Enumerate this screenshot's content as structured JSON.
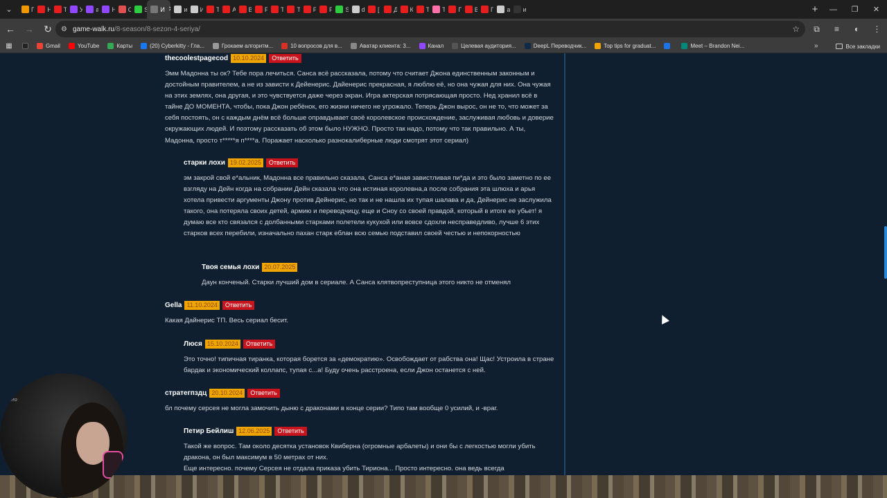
{
  "browser": {
    "tabs": [
      {
        "text": "П",
        "color": "#f29900",
        "icon": "page-icon"
      },
      {
        "text": "Н",
        "color": "#e81e1e",
        "icon": "youtube-icon"
      },
      {
        "text": "Т",
        "color": "#e81e1e",
        "icon": "youtube-icon"
      },
      {
        "text": "У",
        "color": "#9146ff",
        "icon": "twitch-icon"
      },
      {
        "text": "а",
        "color": "#9146ff",
        "icon": "twitch-icon"
      },
      {
        "text": "Н",
        "color": "#9146ff",
        "icon": "twitch-icon"
      },
      {
        "text": "С",
        "color": "#e05050",
        "icon": "page-icon"
      },
      {
        "text": "S",
        "color": "#2ecc40",
        "icon": "page-icon"
      },
      {
        "text": "И",
        "color": "#777777",
        "icon": "page-icon",
        "active": true
      },
      {
        "text": "и",
        "color": "#cccccc",
        "icon": "google-icon"
      },
      {
        "text": "И",
        "color": "#cccccc",
        "icon": "page-icon"
      },
      {
        "text": "Т",
        "color": "#e81e1e",
        "icon": "youtube-icon"
      },
      {
        "text": "А",
        "color": "#e81e1e",
        "icon": "youtube-icon"
      },
      {
        "text": "В",
        "color": "#e81e1e",
        "icon": "youtube-icon"
      },
      {
        "text": "F",
        "color": "#e81e1e",
        "icon": "youtube-icon"
      },
      {
        "text": "Т",
        "color": "#e81e1e",
        "icon": "youtube-icon"
      },
      {
        "text": "Т",
        "color": "#e81e1e",
        "icon": "youtube-icon"
      },
      {
        "text": "Р",
        "color": "#e81e1e",
        "icon": "youtube-icon"
      },
      {
        "text": "F",
        "color": "#e81e1e",
        "icon": "youtube-icon"
      },
      {
        "text": "S",
        "color": "#2ecc40",
        "icon": "page-icon"
      },
      {
        "text": "d",
        "color": "#cccccc",
        "icon": "google-icon"
      },
      {
        "text": "[",
        "color": "#e81e1e",
        "icon": "youtube-icon"
      },
      {
        "text": "Д",
        "color": "#e81e1e",
        "icon": "youtube-icon"
      },
      {
        "text": "К",
        "color": "#e81e1e",
        "icon": "youtube-icon"
      },
      {
        "text": "Т",
        "color": "#e81e1e",
        "icon": "youtube-icon"
      },
      {
        "text": "Т",
        "color": "#ff6fa8",
        "icon": "page-icon"
      },
      {
        "text": "Г",
        "color": "#e81e1e",
        "icon": "youtube-icon"
      },
      {
        "text": "В",
        "color": "#e81e1e",
        "icon": "youtube-icon"
      },
      {
        "text": "Г",
        "color": "#e81e1e",
        "icon": "youtube-icon"
      },
      {
        "text": "а",
        "color": "#cccccc",
        "icon": "google-icon"
      },
      {
        "text": "и",
        "color": "#333333",
        "icon": "page-icon"
      }
    ],
    "url_host": "game-walk.ru",
    "url_path": "/8-season/8-sezon-4-seriya/",
    "bookmarks": [
      {
        "label": "Gmail",
        "color": "#ea4335"
      },
      {
        "label": "YouTube",
        "color": "#ff0000"
      },
      {
        "label": "Карты",
        "color": "#34a853"
      },
      {
        "label": "(20) Cyberkitty - Гла...",
        "color": "#1877f2"
      },
      {
        "label": "Грокаем алгоритм...",
        "color": "#999999"
      },
      {
        "label": "10 вопросов для в...",
        "color": "#d93025"
      },
      {
        "label": "Аватар клиента: 3...",
        "color": "#888888"
      },
      {
        "label": "Канал",
        "color": "#9146ff"
      },
      {
        "label": "Целевая аудитория...",
        "color": "#555555"
      },
      {
        "label": "DeepL Переводчик...",
        "color": "#0f2b46"
      },
      {
        "label": "Top tips for graduat...",
        "color": "#f0a500"
      },
      {
        "label": "",
        "color": "#1a73e8"
      },
      {
        "label": "Meet – Brandon Nei...",
        "color": "#00897b"
      }
    ],
    "bookmarks_all": "Все закладки"
  },
  "comments": [
    {
      "author": "thecoolestpagecod",
      "date": "10.10.2024",
      "reply": "Ответить",
      "text": "Эмм Мадонна ты ок? Тебе пора лечиться. Санса всё рассказала, потому что считает Джона единственным законным и достойным правителем, а не из зависти к Дейенерис. Дайенерис прекрасная, я люблю её, но она чужая для них. Она чужая на этих землях, она другая, и это чувствуется даже через экран. Игра актерская потрясающая просто. Нед хранил всё в тайне ДО МОМЕНТА, чтобы, пока Джон ребёнок, его жизни ничего не угрожало. Теперь Джон вырос, он не то, что может за себя постоять, он с каждым днём всё больше оправдывает своё королевское происхождение, заслуживая любовь и доверие окружающих людей. И поэтому рассказать об этом было НУЖНО. Просто так надо, потому что так правильно. А ты, Мадонна, просто т*****я п****а. Поражает насколько разнокалиберные люди смотрят этот сериал)"
    },
    {
      "author": "старки лохи",
      "date": "19.02.2025",
      "reply": "Ответить",
      "text": "эм закрой свой е*альник, Мадонна все правильно сказала, Санса е*аная завистливая пи*да и это было заметно по ее взгляду на Дейн когда на собрании Дейн сказала что она истиная королевна,а после собрания эта шлюха и арья хотела привести аргументы Джону против Дейнерис, но так и не нашла их тупая шалава и да, Дейнерис не заслужила такого, она потеряла своих детей, армию и переводчицу, еще и Сноу со своей правдой, который в итоге ее убьет! я думаю все кто связался с долбанными старками полетели кукухой или вовсе сдохли несправедливо, лучше 6 этих старков всех перебили, изначально пахан старк еблан всю семью подставил своей честью и непокорностью"
    },
    {
      "author": "Твоя семья лохи",
      "date": "20.07.2025",
      "reply": "",
      "text": "Даун конченый. Старки лучший дом в сериале. А Санса клятвопреступница этого никто не отменял"
    },
    {
      "author": "Gella",
      "date": "11.10.2024",
      "reply": "Ответить",
      "text": "Какая Дайнерис ТП. Весь сериал бесит."
    },
    {
      "author": "Люся",
      "date": "15.10.2024",
      "reply": "Ответить",
      "text": "Это точно! типичная тиранка, которая борется за «демократию». Освобождает от рабства она! Щас! Устроила в стране бардак и экономический коллапс, тупая с...а! Буду очень расстроена, если Джон останется с ней."
    },
    {
      "author": "стратегпздц",
      "date": "20.10.2024",
      "reply": "Ответить",
      "text": "бл почему серсея не могла замочить дыню с драконами в конце серии? Типо там вообще 0 усилий, и -враг."
    },
    {
      "author": "Петир Бейлиш",
      "date": "12.06.2025",
      "reply": "Ответить",
      "text": "Такой же вопрос. Там около десятка установок Квиберна (огромные арбалеты) и они бы с легкостью могли убить дракона, он был максимум в 50 метрах от них.\nЕще интересно. почему Серсея не отдала приказа убить Тириона... Просто интересно. она ведь всегда"
    }
  ],
  "webcam": {
    "label": "Aero"
  }
}
